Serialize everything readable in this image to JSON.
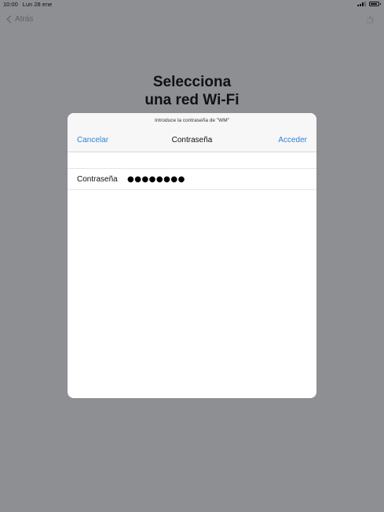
{
  "status_bar": {
    "time": "10:00",
    "date": "Lun 28 ene",
    "signal_bars": 3,
    "battery_level": 0.85
  },
  "nav": {
    "back_label": "Atrás"
  },
  "page": {
    "title_line1": "Selecciona",
    "title_line2": "una red Wi-Fi"
  },
  "modal": {
    "prompt": "Introduce la contraseña de \"WM\"",
    "cancel_label": "Cancelar",
    "title": "Contraseña",
    "join_label": "Acceder",
    "password_label": "Contraseña",
    "password_mask": "●●●●●●●●"
  },
  "colors": {
    "backdrop": "#8e8f93",
    "accent": "#2f83d9"
  }
}
